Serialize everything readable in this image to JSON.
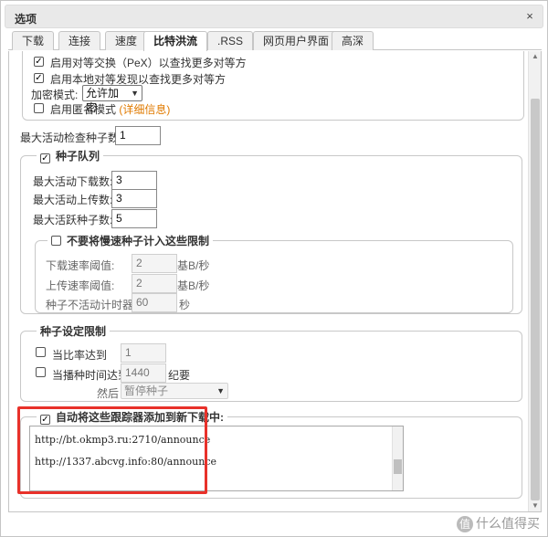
{
  "window": {
    "title": "选项",
    "close_glyph": "×"
  },
  "tabs": [
    {
      "label": "下载"
    },
    {
      "label": "连接"
    },
    {
      "label": "速度"
    },
    {
      "label": "比特洪流",
      "active": true
    },
    {
      "label": ".RSS"
    },
    {
      "label": "网页用户界面"
    },
    {
      "label": "高深"
    }
  ],
  "privacy": {
    "pex_label": "启用对等交换（PeX）以查找更多对等方",
    "pex_checked": true,
    "lsd_label": "启用本地对等发现以查找更多对等方",
    "lsd_checked": true,
    "encryption_label": "加密模式:",
    "encryption_value": "允许加密",
    "anon_label": "启用匿名模式",
    "anon_checked": false,
    "details_link": "(详细信息)"
  },
  "checking": {
    "label": "最大活动检查种子数:",
    "value": "1"
  },
  "queue": {
    "legend": "种子队列",
    "enabled": true,
    "max_downloads_label": "最大活动下载数:",
    "max_downloads": "3",
    "max_uploads_label": "最大活动上传数:",
    "max_uploads": "3",
    "max_torrents_label": "最大活跃种子数:",
    "max_torrents": "5",
    "slow": {
      "legend": "不要将慢速种子计入这些限制",
      "enabled": false,
      "dl_label": "下载速率阈值:",
      "dl_value": "2",
      "dl_unit": "基B/秒",
      "ul_label": "上传速率阈值:",
      "ul_value": "2",
      "ul_unit": "基B/秒",
      "idle_label": "种子不活动计时器:",
      "idle_value": "60",
      "idle_unit": "秒"
    }
  },
  "seeding": {
    "legend": "种子设定限制",
    "ratio_label": "当比率达到",
    "ratio_checked": false,
    "ratio_value": "1",
    "time_label": "当播种时间达到",
    "time_checked": false,
    "time_value": "1440",
    "time_unit": "纪要",
    "then_label": "然后",
    "then_action": "暂停种子"
  },
  "trackers": {
    "legend": "自动将这些跟踪器添加到新下载中:",
    "enabled": true,
    "lines": [
      "http://bt.okmp3.ru:2710/announce",
      "http://1337.abcvg.info:80/announce"
    ]
  },
  "watermark": {
    "badge": "值",
    "text": "什么值得买"
  },
  "colors": {
    "highlight": "#e8312a",
    "link": "#e07a00"
  }
}
